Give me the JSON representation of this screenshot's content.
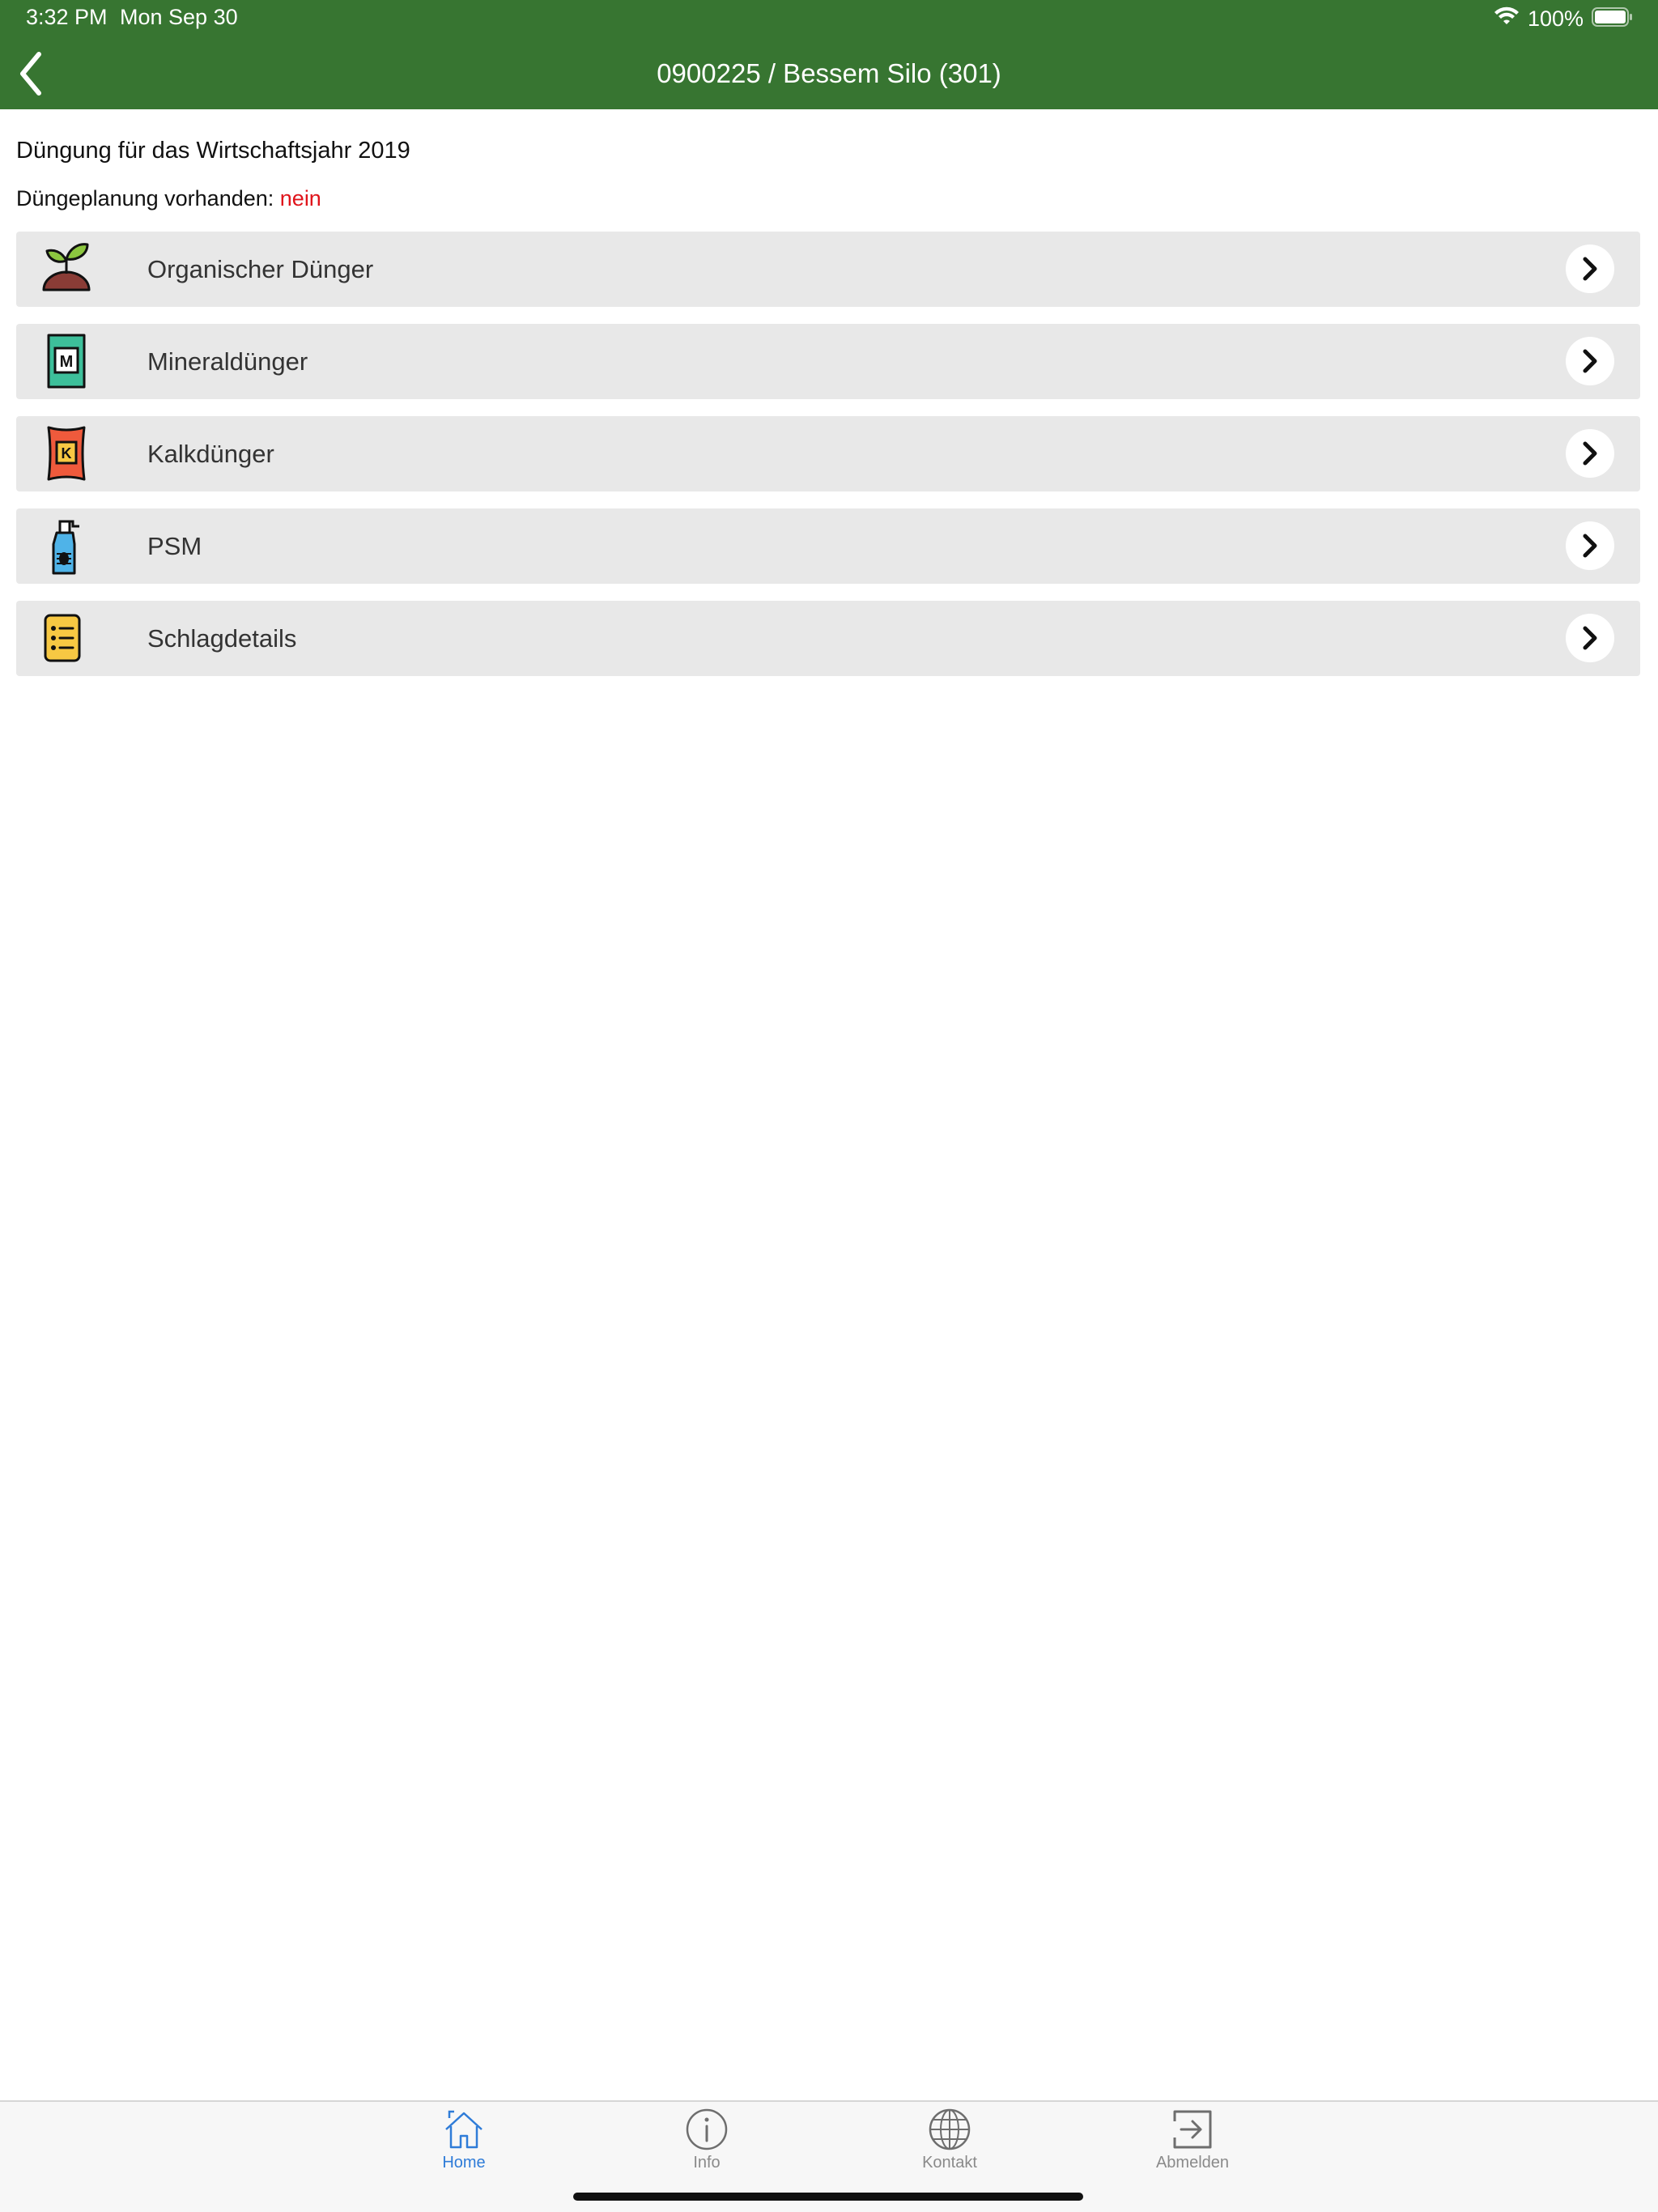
{
  "status_bar": {
    "time": "3:32 PM",
    "date": "Mon Sep 30",
    "battery": "100%"
  },
  "nav": {
    "title": "0900225 / Bessem Silo (301)",
    "back_icon": "chevron-left-icon"
  },
  "content": {
    "title": "Düngung für das Wirtschaftsjahr 2019",
    "planning_label": "Düngeplanung vorhanden:",
    "planning_value": "nein",
    "planning_value_color": "#e0141b"
  },
  "menu": {
    "items": [
      {
        "label": "Organischer Dünger",
        "icon": "seedling-icon"
      },
      {
        "label": "Mineraldünger",
        "icon": "mineral-fertilizer-bag-icon",
        "icon_letter": "M"
      },
      {
        "label": "Kalkdünger",
        "icon": "lime-fertilizer-bag-icon",
        "icon_letter": "K"
      },
      {
        "label": "PSM",
        "icon": "spray-bottle-icon"
      },
      {
        "label": "Schlagdetails",
        "icon": "list-document-icon"
      }
    ]
  },
  "tabs": [
    {
      "label": "Home",
      "icon": "home-icon",
      "active": true
    },
    {
      "label": "Info",
      "icon": "info-icon",
      "active": false
    },
    {
      "label": "Kontakt",
      "icon": "globe-icon",
      "active": false
    },
    {
      "label": "Abmelden",
      "icon": "logout-icon",
      "active": false
    }
  ],
  "colors": {
    "header": "#377531",
    "tab_active": "#2f7cd8",
    "tab_inactive": "#8a8a8a",
    "row_background": "#e8e8e8"
  }
}
